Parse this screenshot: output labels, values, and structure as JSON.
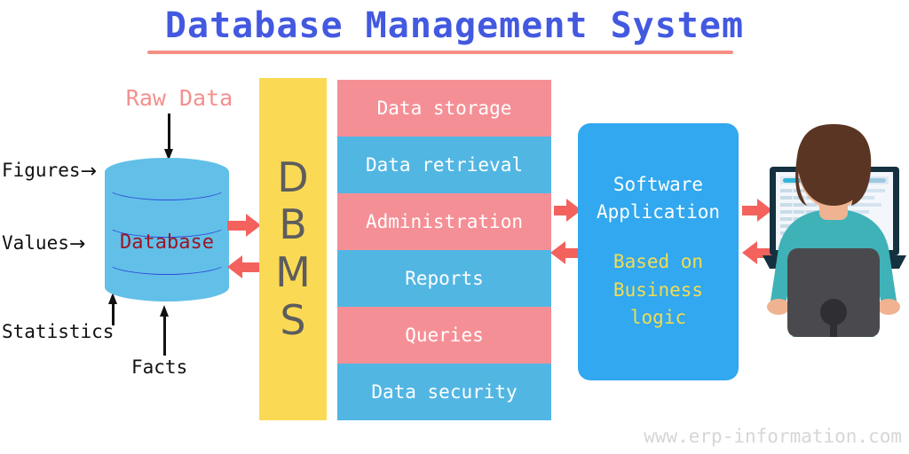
{
  "title": "Database Management System",
  "accent_colors": {
    "title_blue": "#4359e0",
    "title_underline": "#f58f85",
    "cylinder_blue": "#62c0e8",
    "cylinder_ring": "#2e4bd8",
    "database_text": "#9c1526",
    "raw_data_salmon": "#f58f8f",
    "dbms_yellow": "#fada54",
    "dbms_letter": "#5d5d5d",
    "row_pink": "#f58f96",
    "row_blue": "#52b6e3",
    "app_blue": "#31a8ef",
    "app_sub_yellow": "#f3dc52",
    "red_arrow": "#f4625e",
    "watermark_gray": "#d6d6d6",
    "shirt_teal": "#3fb2b8",
    "hair_brown": "#5b3524",
    "chair_gray": "#4a4a4e"
  },
  "database": {
    "center_label": "Database",
    "top_label": "Raw Data",
    "left_labels": [
      {
        "text": "Figures",
        "arrow": "→"
      },
      {
        "text": "Values",
        "arrow": "→"
      }
    ],
    "bottom_labels": [
      {
        "text": "Statistics"
      },
      {
        "text": "Facts"
      }
    ]
  },
  "dbms": {
    "letters": [
      "D",
      "B",
      "M",
      "S"
    ],
    "expansion": "Database Management System"
  },
  "services": [
    {
      "label": "Data storage",
      "color": "pink"
    },
    {
      "label": "Data retrieval",
      "color": "blue"
    },
    {
      "label": "Administration",
      "color": "pink"
    },
    {
      "label": "Reports",
      "color": "blue"
    },
    {
      "label": "Queries",
      "color": "pink"
    },
    {
      "label": "Data security",
      "color": "blue"
    }
  ],
  "application": {
    "title_line1": "Software",
    "title_line2": "Application",
    "sub_line1": "Based on",
    "sub_line2": "Business",
    "sub_line3": "logic"
  },
  "user": {
    "description": "person at laptop seen from behind"
  },
  "watermark": "www.erp-information.com"
}
